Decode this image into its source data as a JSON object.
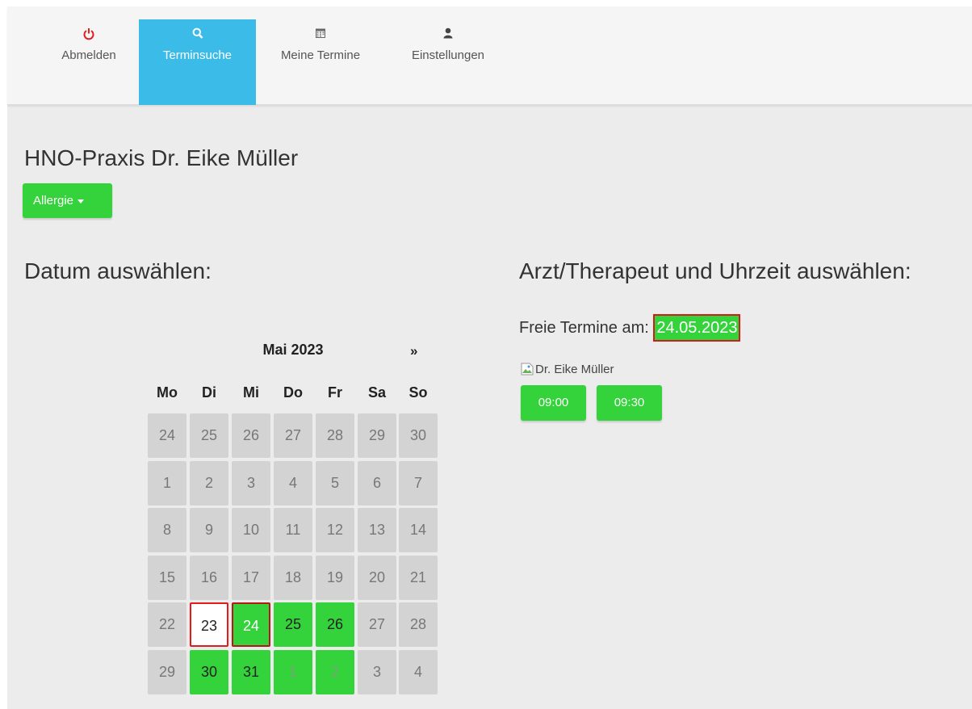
{
  "nav": {
    "items": [
      {
        "label": "Abmelden",
        "icon": "power-icon",
        "active": false,
        "icon_color": "#e02020"
      },
      {
        "label": "Terminsuche",
        "icon": "search-icon",
        "active": true
      },
      {
        "label": "Meine Termine",
        "icon": "calendar-icon",
        "active": false
      },
      {
        "label": "Einstellungen",
        "icon": "user-icon",
        "active": false
      }
    ]
  },
  "practice": {
    "title": "HNO-Praxis Dr. Eike Müller",
    "category_label": "Allergie"
  },
  "date_section": {
    "heading": "Datum auswählen:",
    "calendar": {
      "month": "Mai 2023",
      "next": "»",
      "weekdays": [
        "Mo",
        "Di",
        "Mi",
        "Do",
        "Fr",
        "Sa",
        "So"
      ],
      "weeks": [
        [
          {
            "d": "24",
            "s": "off"
          },
          {
            "d": "25",
            "s": "off"
          },
          {
            "d": "26",
            "s": "off"
          },
          {
            "d": "27",
            "s": "off"
          },
          {
            "d": "28",
            "s": "off"
          },
          {
            "d": "29",
            "s": "off"
          },
          {
            "d": "30",
            "s": "off"
          }
        ],
        [
          {
            "d": "1",
            "s": "off"
          },
          {
            "d": "2",
            "s": "off"
          },
          {
            "d": "3",
            "s": "off"
          },
          {
            "d": "4",
            "s": "off"
          },
          {
            "d": "5",
            "s": "off"
          },
          {
            "d": "6",
            "s": "off"
          },
          {
            "d": "7",
            "s": "off"
          }
        ],
        [
          {
            "d": "8",
            "s": "off"
          },
          {
            "d": "9",
            "s": "off"
          },
          {
            "d": "10",
            "s": "off"
          },
          {
            "d": "11",
            "s": "off"
          },
          {
            "d": "12",
            "s": "off"
          },
          {
            "d": "13",
            "s": "off"
          },
          {
            "d": "14",
            "s": "off"
          }
        ],
        [
          {
            "d": "15",
            "s": "off"
          },
          {
            "d": "16",
            "s": "off"
          },
          {
            "d": "17",
            "s": "off"
          },
          {
            "d": "18",
            "s": "off"
          },
          {
            "d": "19",
            "s": "off"
          },
          {
            "d": "20",
            "s": "off"
          },
          {
            "d": "21",
            "s": "off"
          }
        ],
        [
          {
            "d": "22",
            "s": "off"
          },
          {
            "d": "23",
            "s": "today"
          },
          {
            "d": "24",
            "s": "selected"
          },
          {
            "d": "25",
            "s": "free"
          },
          {
            "d": "26",
            "s": "free"
          },
          {
            "d": "27",
            "s": "off"
          },
          {
            "d": "28",
            "s": "off"
          }
        ],
        [
          {
            "d": "29",
            "s": "off"
          },
          {
            "d": "30",
            "s": "free"
          },
          {
            "d": "31",
            "s": "free"
          },
          {
            "d": "1",
            "s": "free-other-month"
          },
          {
            "d": "2",
            "s": "free-other-month"
          },
          {
            "d": "3",
            "s": "off"
          },
          {
            "d": "4",
            "s": "off"
          }
        ]
      ]
    }
  },
  "appointment_section": {
    "heading": "Arzt/Therapeut und Uhrzeit auswählen:",
    "free_label": "Freie Termine am:",
    "free_date": "24.05.2023",
    "doctor": "Dr. Eike Müller",
    "slots": [
      "09:00",
      "09:30"
    ]
  },
  "colors": {
    "accent_blue": "#3bbbe8",
    "free_green": "#35d33b",
    "highlight_red": "#e21b1b"
  }
}
